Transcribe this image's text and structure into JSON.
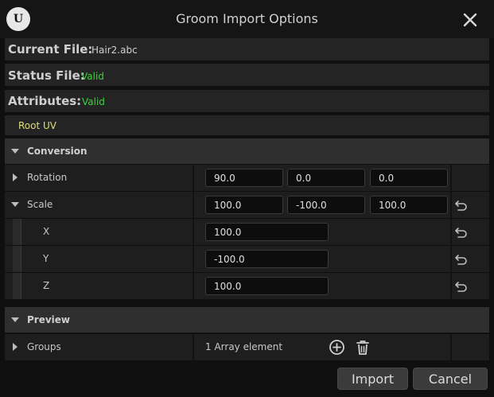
{
  "window": {
    "title": "Groom Import Options",
    "logo_text": "U"
  },
  "info": {
    "current_file_label": "Current File:",
    "current_file_value": "Hair2.abc",
    "status_label": "Status File:",
    "status_value": "Valid",
    "attributes_label": "Attributes:",
    "attributes_value": "Valid",
    "attribute_item": "Root UV"
  },
  "conversion": {
    "section_label": "Conversion",
    "rotation": {
      "label": "Rotation",
      "x": "90.0",
      "y": "0.0",
      "z": "0.0"
    },
    "scale": {
      "label": "Scale",
      "x": "100.0",
      "y": "-100.0",
      "z": "100.0"
    },
    "scale_x": {
      "label": "X",
      "value": "100.0"
    },
    "scale_y": {
      "label": "Y",
      "value": "-100.0"
    },
    "scale_z": {
      "label": "Z",
      "value": "100.0"
    }
  },
  "preview": {
    "section_label": "Preview",
    "groups": {
      "label": "Groups",
      "value": "1 Array element"
    }
  },
  "buttons": {
    "import": "Import",
    "cancel": "Cancel"
  },
  "colors": {
    "valid": "#3fd13f",
    "attribute": "#dede7a",
    "background": "#0f0f0f"
  }
}
